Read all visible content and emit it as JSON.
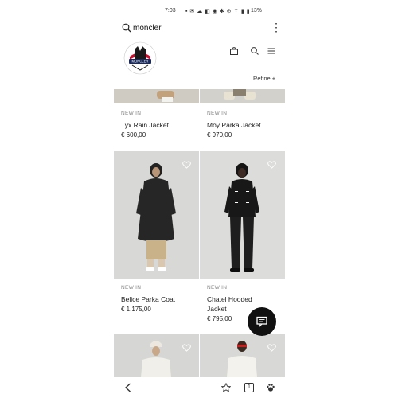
{
  "status": {
    "time": "7:03",
    "icons": "▪ ✉ ☁ ◧  ◉ ✱ ⊘ ⌔ ▮ ▮",
    "battery": "13%"
  },
  "search": {
    "query": "moncler"
  },
  "brand": {
    "logo_text": "MONCLER"
  },
  "header": {
    "refine_label": "Refine +"
  },
  "products": [
    {
      "tag": "NEW IN",
      "name": "Tyx Rain Jacket",
      "price": "€ 600,00"
    },
    {
      "tag": "NEW IN",
      "name": "Moy Parka Jacket",
      "price": "€ 970,00"
    },
    {
      "tag": "NEW IN",
      "name": "Belice Parka Coat",
      "price": "€ 1.175,00"
    },
    {
      "tag": "NEW IN",
      "name_line1": "Chatel Hooded",
      "name_line2": "Jacket",
      "price": "€ 795,00"
    }
  ],
  "nav": {
    "tabs_count": "1"
  },
  "colors": {
    "accent": "#111111",
    "photo_bg": "#d8d8d6"
  }
}
